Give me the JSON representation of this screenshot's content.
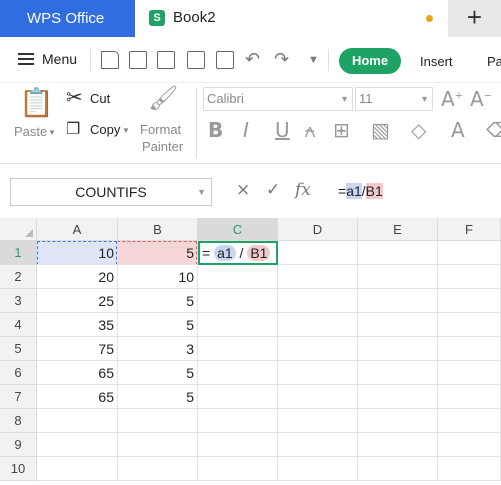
{
  "title_bar": {
    "app_tab": "WPS Office",
    "doc_tab": "Book2",
    "new_tab": "+"
  },
  "menubar": {
    "menu_label": "Menu",
    "tabs": [
      "Home",
      "Insert",
      "Pa"
    ]
  },
  "ribbon": {
    "paste_label": "Paste",
    "cut_label": "Cut",
    "copy_label": "Copy",
    "format_painter_label": [
      "Format",
      "Painter"
    ],
    "font_name": "Calibri",
    "font_size": "11",
    "bold": "B",
    "italic": "I",
    "underline": "U",
    "font_color": "A"
  },
  "formula_bar": {
    "name_box": "COUNTIFS",
    "cancel_glyph": "×",
    "confirm_glyph": "✓",
    "fx_glyph": "fx",
    "formula_parts": [
      "=",
      "a1",
      "/",
      "B1"
    ]
  },
  "sheet": {
    "columns": [
      "A",
      "B",
      "C",
      "D",
      "E",
      "F"
    ],
    "rows": [
      "1",
      "2",
      "3",
      "4",
      "5",
      "6",
      "7",
      "8",
      "9",
      "10"
    ],
    "col_a": [
      "10",
      "20",
      "25",
      "35",
      "75",
      "65",
      "65",
      "",
      "",
      ""
    ],
    "col_b": [
      "5",
      "10",
      "5",
      "5",
      "3",
      "5",
      "5",
      "",
      "",
      ""
    ],
    "c1_edit": [
      "=",
      "a1",
      "/",
      "B1"
    ]
  },
  "colors": {
    "accent": "#1ea365",
    "wps_blue": "#2f6de1",
    "ref_blue": "#c9d6f2",
    "ref_red": "#f4c9c9"
  }
}
